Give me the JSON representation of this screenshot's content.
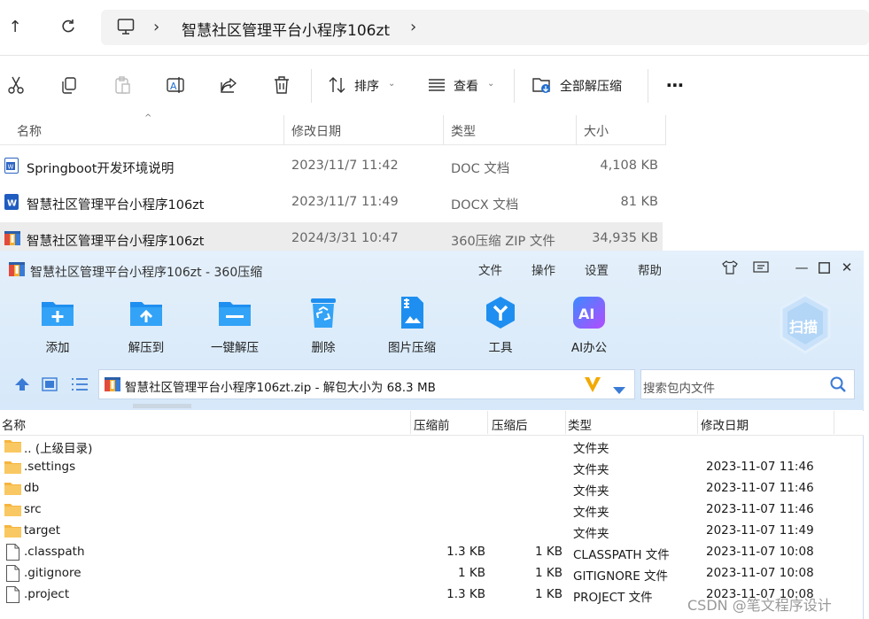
{
  "explorer": {
    "breadcrumb_folder": "智慧社区管理平台小程序106zt",
    "cmd": {
      "sort": "排序",
      "view": "查看",
      "extract_all": "全部解压缩"
    },
    "headers": {
      "name": "名称",
      "modified": "修改日期",
      "type": "类型",
      "size": "大小"
    },
    "files": [
      {
        "name": "Springboot开发环境说明",
        "modified": "2023/11/7 11:42",
        "type": "DOC 文档",
        "size": "4,108 KB"
      },
      {
        "name": "智慧社区管理平台小程序106zt",
        "modified": "2023/11/7 11:49",
        "type": "DOCX 文档",
        "size": "81 KB"
      },
      {
        "name": "智慧社区管理平台小程序106zt",
        "modified": "2024/3/31 10:47",
        "type": "360压缩 ZIP 文件",
        "size": "34,935 KB"
      }
    ]
  },
  "zip": {
    "title": "智慧社区管理平台小程序106zt - 360压缩",
    "menu": [
      "文件",
      "操作",
      "设置",
      "帮助"
    ],
    "tools": [
      "添加",
      "解压到",
      "一键解压",
      "删除",
      "图片压缩",
      "工具",
      "AI办公"
    ],
    "scan": "扫描",
    "path": "智慧社区管理平台小程序106zt.zip - 解包大小为 68.3 MB",
    "search_placeholder": "搜索包内文件",
    "headers": {
      "name": "名称",
      "before": "压缩前",
      "after": "压缩后",
      "type": "类型",
      "modified": "修改日期"
    },
    "rows": [
      {
        "name": ".. (上级目录)",
        "before": "",
        "after": "",
        "type": "文件夹",
        "modified": ""
      },
      {
        "name": ".settings",
        "before": "",
        "after": "",
        "type": "文件夹",
        "modified": "2023-11-07 11:46"
      },
      {
        "name": "db",
        "before": "",
        "after": "",
        "type": "文件夹",
        "modified": "2023-11-07 11:46"
      },
      {
        "name": "src",
        "before": "",
        "after": "",
        "type": "文件夹",
        "modified": "2023-11-07 11:46"
      },
      {
        "name": "target",
        "before": "",
        "after": "",
        "type": "文件夹",
        "modified": "2023-11-07 11:49"
      },
      {
        "name": ".classpath",
        "before": "1.3 KB",
        "after": "1 KB",
        "type": "CLASSPATH 文件",
        "modified": "2023-11-07 10:08"
      },
      {
        "name": ".gitignore",
        "before": "1 KB",
        "after": "1 KB",
        "type": "GITIGNORE 文件",
        "modified": "2023-11-07 10:08"
      },
      {
        "name": ".project",
        "before": "1.3 KB",
        "after": "1 KB",
        "type": "PROJECT 文件",
        "modified": "2023-11-07 10:08"
      }
    ]
  },
  "watermark": "CSDN @笔文程序设计"
}
